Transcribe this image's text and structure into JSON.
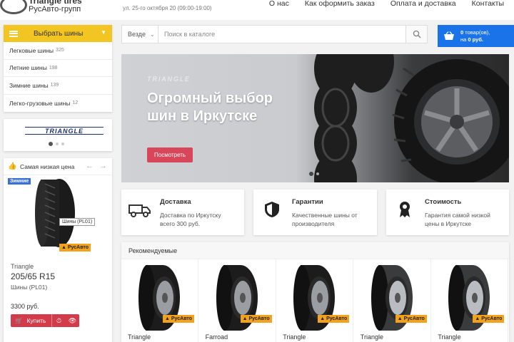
{
  "header": {
    "logo_title": "Triangle tires",
    "logo_subtitle": "РусАвто-групп",
    "address": "ул. 25-го октября 20 (09:00-19:00)",
    "nav": [
      "О нас",
      "Как оформить заказ",
      "Оплата и доставка",
      "Контакты"
    ]
  },
  "catalog": {
    "button_label": "Выбрать шины",
    "items": [
      {
        "label": "Легковые шины",
        "count": "325"
      },
      {
        "label": "Летние шины",
        "count": "198"
      },
      {
        "label": "Зимние шины",
        "count": "139"
      },
      {
        "label": "Легко-грузовые шины",
        "count": "12"
      }
    ]
  },
  "brand_carousel": {
    "logo_text": "TRIANGLE"
  },
  "deal": {
    "title": "Самая низкая цена",
    "badge": "Зимние",
    "tooltip": "Шины (PL01)",
    "seller_tag": "РусАвто",
    "brand": "Triangle",
    "size": "205/65 R15",
    "model": "Шины (PL01)",
    "price": "3300 руб.",
    "buy_label": "Купить"
  },
  "search": {
    "scope": "Везде",
    "placeholder": "Поиск в каталоге"
  },
  "cart": {
    "line1_count": "0",
    "line1_suffix": " товар(ов),",
    "line2_prefix": "на ",
    "line2_amount": "0 руб."
  },
  "banner": {
    "watermark": "TRIANGLE",
    "headline_line1": "Огромный выбор",
    "headline_line2": "шин в Иркутске",
    "button_label": "Посмотреть"
  },
  "features": [
    {
      "title": "Доставка",
      "desc_line1": "Доставка по Иркутску",
      "desc_line2": "всего 300 руб.",
      "icon": "truck-icon"
    },
    {
      "title": "Гарантии",
      "desc_line1": "Качественные шины от",
      "desc_line2": "производителя",
      "icon": "shield-icon"
    },
    {
      "title": "Стоимость",
      "desc_line1": "Гарантия самой низкой",
      "desc_line2": "цены в Иркутске",
      "icon": "award-icon"
    }
  ],
  "recommended": {
    "title": "Рекомендуемые",
    "seller_tag": "РусАвто",
    "products": [
      {
        "brand": "Triangle",
        "tread": "winter"
      },
      {
        "brand": "Farroad",
        "tread": "summer"
      },
      {
        "brand": "Triangle",
        "tread": "winter"
      },
      {
        "brand": "Triangle",
        "tread": "studless"
      },
      {
        "brand": "Triangle",
        "tread": "studless"
      }
    ]
  },
  "colors": {
    "catalog_accent": "#f3c522",
    "cart_blue": "#1a73e8",
    "buy_red": "#d33a4a",
    "tag_orange": "#f3a31b"
  }
}
